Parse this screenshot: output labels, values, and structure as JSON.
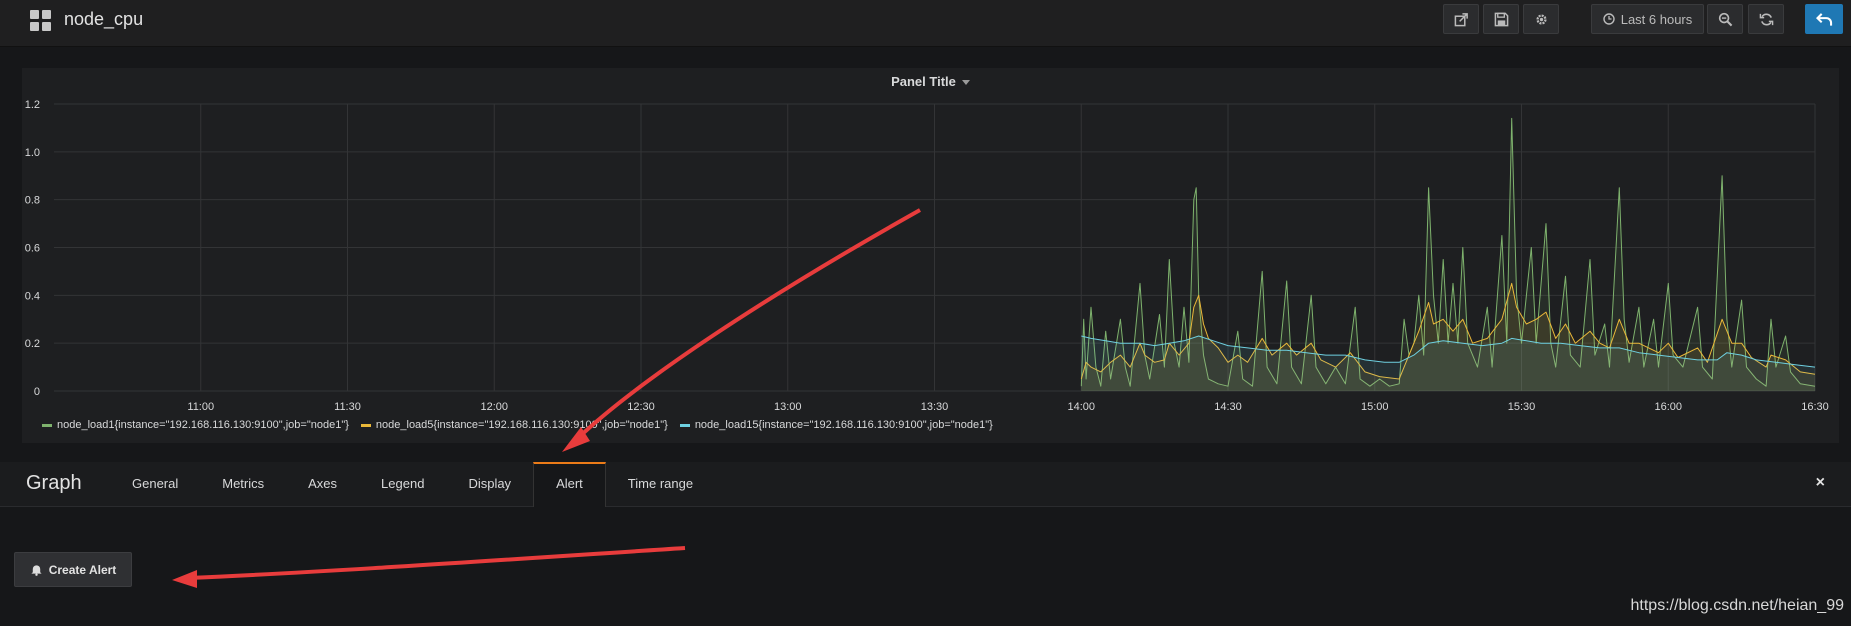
{
  "header": {
    "title": "node_cpu",
    "time_range_label": "Last 6 hours"
  },
  "panel": {
    "title": "Panel Title"
  },
  "legend": [
    {
      "label": "node_load1{instance=\"192.168.116.130:9100\",job=\"node1\"}",
      "color": "#7eb26d"
    },
    {
      "label": "node_load5{instance=\"192.168.116.130:9100\",job=\"node1\"}",
      "color": "#eab839"
    },
    {
      "label": "node_load15{instance=\"192.168.116.130:9100\",job=\"node1\"}",
      "color": "#6ed0e0"
    }
  ],
  "editor": {
    "title": "Graph",
    "tabs": [
      "General",
      "Metrics",
      "Axes",
      "Legend",
      "Display",
      "Alert",
      "Time range"
    ],
    "active_tab": "Alert",
    "close_icon": "×",
    "create_alert_label": "Create Alert"
  },
  "watermark": "https://blog.csdn.net/heian_99",
  "chart_data": {
    "type": "line",
    "title": "Panel Title",
    "x_ticks": [
      "11:00",
      "11:30",
      "12:00",
      "12:30",
      "13:00",
      "13:30",
      "14:00",
      "14:30",
      "15:00",
      "15:30",
      "16:00",
      "16:30"
    ],
    "y_ticks": [
      "0",
      "0.2",
      "0.4",
      "0.6",
      "0.8",
      "1.0",
      "1.2"
    ],
    "ylim": [
      0,
      1.2
    ],
    "x_domain_minutes": [
      630,
      990
    ],
    "grid": true,
    "legend_position": "bottom",
    "series": [
      {
        "name": "node_load1{instance=\"192.168.116.130:9100\",job=\"node1\"}",
        "color": "#7eb26d",
        "points": [
          [
            840,
            0.02
          ],
          [
            840.5,
            0.3
          ],
          [
            841,
            0.05
          ],
          [
            842,
            0.35
          ],
          [
            843,
            0.1
          ],
          [
            844,
            0.02
          ],
          [
            845,
            0.25
          ],
          [
            846,
            0.05
          ],
          [
            848,
            0.3
          ],
          [
            849,
            0.1
          ],
          [
            850,
            0.02
          ],
          [
            852,
            0.45
          ],
          [
            853,
            0.15
          ],
          [
            854,
            0.05
          ],
          [
            856,
            0.32
          ],
          [
            857,
            0.1
          ],
          [
            858,
            0.55
          ],
          [
            859,
            0.2
          ],
          [
            860,
            0.1
          ],
          [
            861,
            0.35
          ],
          [
            862,
            0.12
          ],
          [
            863,
            0.8
          ],
          [
            863.5,
            0.85
          ],
          [
            864,
            0.4
          ],
          [
            865,
            0.15
          ],
          [
            866,
            0.05
          ],
          [
            868,
            0.03
          ],
          [
            870,
            0.02
          ],
          [
            872,
            0.25
          ],
          [
            873,
            0.05
          ],
          [
            875,
            0.02
          ],
          [
            877,
            0.5
          ],
          [
            878,
            0.1
          ],
          [
            880,
            0.03
          ],
          [
            882,
            0.46
          ],
          [
            883,
            0.1
          ],
          [
            885,
            0.03
          ],
          [
            887,
            0.4
          ],
          [
            888,
            0.1
          ],
          [
            890,
            0.03
          ],
          [
            892,
            0.1
          ],
          [
            894,
            0.03
          ],
          [
            896,
            0.35
          ],
          [
            897,
            0.05
          ],
          [
            899,
            0.02
          ],
          [
            901,
            0.05
          ],
          [
            903,
            0.02
          ],
          [
            905,
            0.03
          ],
          [
            906,
            0.3
          ],
          [
            907,
            0.15
          ],
          [
            908,
            0.2
          ],
          [
            909,
            0.4
          ],
          [
            910,
            0.15
          ],
          [
            911,
            0.85
          ],
          [
            912,
            0.4
          ],
          [
            913,
            0.2
          ],
          [
            914,
            0.55
          ],
          [
            915,
            0.2
          ],
          [
            916,
            0.45
          ],
          [
            917,
            0.2
          ],
          [
            918,
            0.6
          ],
          [
            919,
            0.2
          ],
          [
            921,
            0.1
          ],
          [
            923,
            0.35
          ],
          [
            924,
            0.1
          ],
          [
            926,
            0.65
          ],
          [
            927,
            0.2
          ],
          [
            928,
            1.14
          ],
          [
            929,
            0.4
          ],
          [
            930,
            0.2
          ],
          [
            932,
            0.6
          ],
          [
            933,
            0.2
          ],
          [
            935,
            0.7
          ],
          [
            936,
            0.2
          ],
          [
            937,
            0.1
          ],
          [
            939,
            0.48
          ],
          [
            940,
            0.15
          ],
          [
            942,
            0.1
          ],
          [
            944,
            0.55
          ],
          [
            945,
            0.15
          ],
          [
            947,
            0.28
          ],
          [
            948,
            0.1
          ],
          [
            950,
            0.85
          ],
          [
            951,
            0.3
          ],
          [
            952,
            0.12
          ],
          [
            954,
            0.35
          ],
          [
            955,
            0.1
          ],
          [
            957,
            0.3
          ],
          [
            958,
            0.1
          ],
          [
            960,
            0.45
          ],
          [
            961,
            0.15
          ],
          [
            963,
            0.1
          ],
          [
            966,
            0.35
          ],
          [
            967,
            0.1
          ],
          [
            969,
            0.05
          ],
          [
            971,
            0.9
          ],
          [
            972,
            0.3
          ],
          [
            973,
            0.1
          ],
          [
            975,
            0.38
          ],
          [
            976,
            0.1
          ],
          [
            978,
            0.05
          ],
          [
            980,
            0.02
          ],
          [
            981,
            0.3
          ],
          [
            982,
            0.1
          ],
          [
            984,
            0.23
          ],
          [
            985,
            0.08
          ],
          [
            987,
            0.03
          ],
          [
            990,
            0.02
          ]
        ]
      },
      {
        "name": "node_load5{instance=\"192.168.116.130:9100\",job=\"node1\"}",
        "color": "#eab839",
        "points": [
          [
            840,
            0.05
          ],
          [
            841,
            0.12
          ],
          [
            842,
            0.1
          ],
          [
            844,
            0.08
          ],
          [
            846,
            0.12
          ],
          [
            848,
            0.15
          ],
          [
            850,
            0.1
          ],
          [
            852,
            0.2
          ],
          [
            853,
            0.15
          ],
          [
            855,
            0.12
          ],
          [
            857,
            0.13
          ],
          [
            858,
            0.2
          ],
          [
            860,
            0.15
          ],
          [
            862,
            0.2
          ],
          [
            863,
            0.35
          ],
          [
            864,
            0.4
          ],
          [
            865,
            0.28
          ],
          [
            866,
            0.22
          ],
          [
            868,
            0.18
          ],
          [
            870,
            0.12
          ],
          [
            872,
            0.15
          ],
          [
            874,
            0.12
          ],
          [
            877,
            0.22
          ],
          [
            879,
            0.15
          ],
          [
            882,
            0.2
          ],
          [
            884,
            0.15
          ],
          [
            887,
            0.2
          ],
          [
            889,
            0.13
          ],
          [
            892,
            0.1
          ],
          [
            895,
            0.16
          ],
          [
            898,
            0.08
          ],
          [
            901,
            0.06
          ],
          [
            905,
            0.05
          ],
          [
            907,
            0.15
          ],
          [
            909,
            0.25
          ],
          [
            911,
            0.37
          ],
          [
            912,
            0.28
          ],
          [
            914,
            0.3
          ],
          [
            916,
            0.25
          ],
          [
            918,
            0.3
          ],
          [
            920,
            0.2
          ],
          [
            923,
            0.22
          ],
          [
            926,
            0.3
          ],
          [
            928,
            0.45
          ],
          [
            929,
            0.35
          ],
          [
            931,
            0.28
          ],
          [
            933,
            0.3
          ],
          [
            935,
            0.33
          ],
          [
            937,
            0.22
          ],
          [
            939,
            0.28
          ],
          [
            941,
            0.2
          ],
          [
            944,
            0.25
          ],
          [
            946,
            0.2
          ],
          [
            948,
            0.18
          ],
          [
            950,
            0.3
          ],
          [
            952,
            0.2
          ],
          [
            954,
            0.2
          ],
          [
            956,
            0.18
          ],
          [
            958,
            0.16
          ],
          [
            960,
            0.2
          ],
          [
            962,
            0.14
          ],
          [
            966,
            0.18
          ],
          [
            968,
            0.12
          ],
          [
            971,
            0.3
          ],
          [
            973,
            0.2
          ],
          [
            975,
            0.2
          ],
          [
            977,
            0.14
          ],
          [
            980,
            0.1
          ],
          [
            981,
            0.15
          ],
          [
            984,
            0.13
          ],
          [
            987,
            0.08
          ],
          [
            990,
            0.07
          ]
        ]
      },
      {
        "name": "node_load15{instance=\"192.168.116.130:9100\",job=\"node1\"}",
        "color": "#6ed0e0",
        "points": [
          [
            840,
            0.23
          ],
          [
            842,
            0.22
          ],
          [
            845,
            0.21
          ],
          [
            848,
            0.2
          ],
          [
            852,
            0.2
          ],
          [
            855,
            0.19
          ],
          [
            858,
            0.2
          ],
          [
            861,
            0.21
          ],
          [
            864,
            0.23
          ],
          [
            867,
            0.21
          ],
          [
            870,
            0.19
          ],
          [
            874,
            0.18
          ],
          [
            878,
            0.17
          ],
          [
            882,
            0.17
          ],
          [
            886,
            0.16
          ],
          [
            890,
            0.15
          ],
          [
            894,
            0.15
          ],
          [
            898,
            0.13
          ],
          [
            902,
            0.12
          ],
          [
            905,
            0.12
          ],
          [
            908,
            0.15
          ],
          [
            911,
            0.2
          ],
          [
            914,
            0.21
          ],
          [
            918,
            0.2
          ],
          [
            922,
            0.19
          ],
          [
            926,
            0.2
          ],
          [
            928,
            0.22
          ],
          [
            931,
            0.21
          ],
          [
            934,
            0.2
          ],
          [
            938,
            0.2
          ],
          [
            942,
            0.19
          ],
          [
            946,
            0.18
          ],
          [
            950,
            0.18
          ],
          [
            954,
            0.16
          ],
          [
            958,
            0.15
          ],
          [
            962,
            0.14
          ],
          [
            966,
            0.13
          ],
          [
            970,
            0.13
          ],
          [
            972,
            0.16
          ],
          [
            975,
            0.15
          ],
          [
            978,
            0.13
          ],
          [
            982,
            0.12
          ],
          [
            986,
            0.11
          ],
          [
            990,
            0.1
          ]
        ]
      }
    ]
  }
}
